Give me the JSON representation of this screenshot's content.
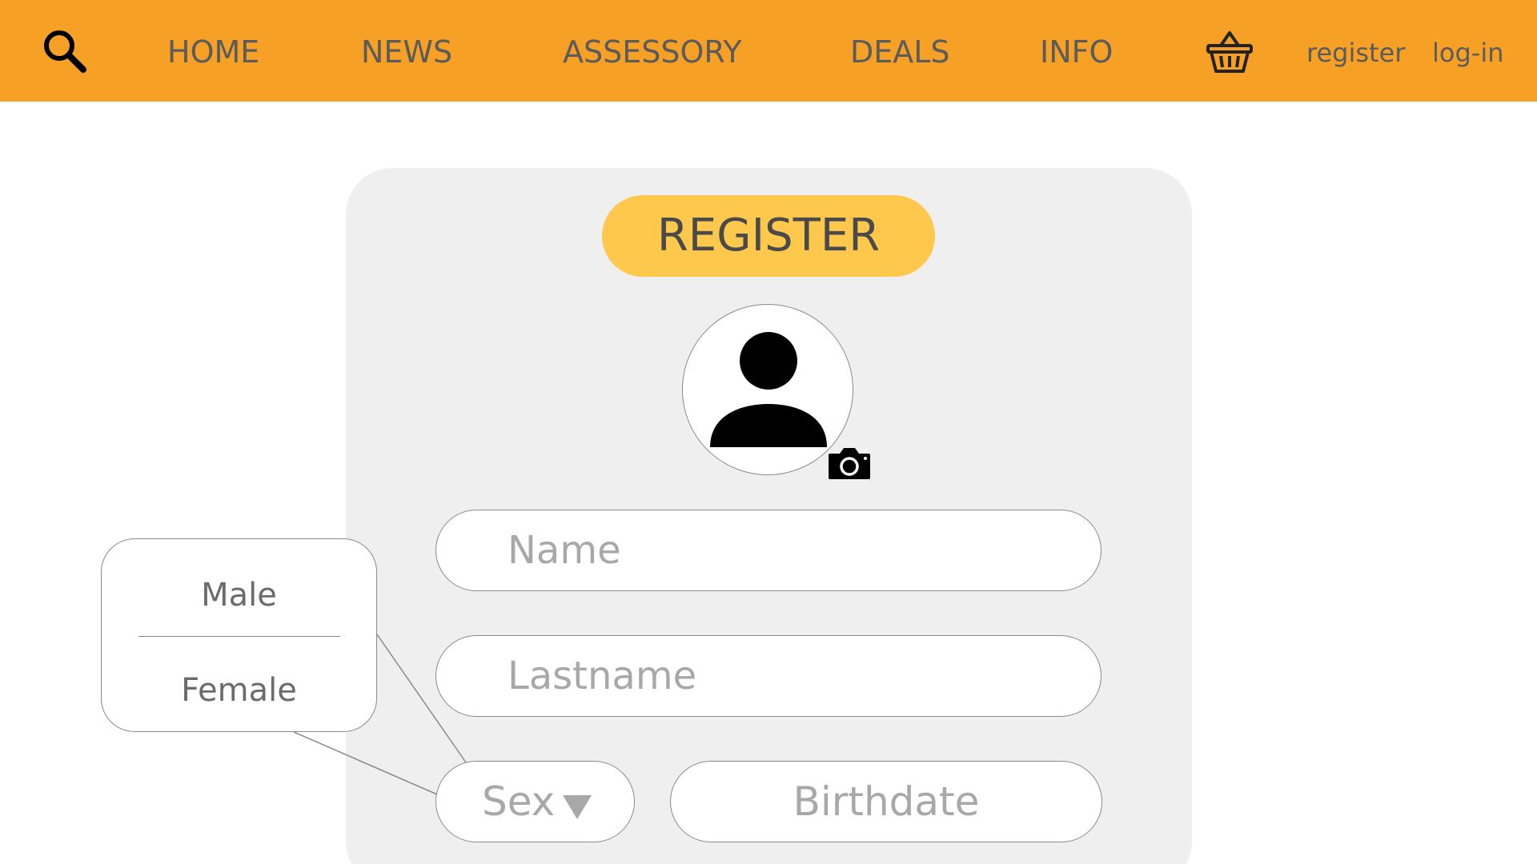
{
  "colors": {
    "nav_background": "#f7a026",
    "title_pill": "#fdc84b",
    "card_background": "#efefef",
    "nav_text": "#5b5b5b",
    "placeholder_text": "#a8a8a8"
  },
  "nav": {
    "search_icon": "search-icon",
    "items": [
      {
        "label": "HOME"
      },
      {
        "label": "NEWS"
      },
      {
        "label": "ASSESSORY"
      },
      {
        "label": "DEALS"
      },
      {
        "label": "INFO"
      }
    ],
    "basket_icon": "basket-icon",
    "register_label": "register",
    "login_label": "log-in"
  },
  "form": {
    "title": "REGISTER",
    "avatar_icon": "user-avatar-icon",
    "camera_icon": "camera-icon",
    "name": {
      "placeholder": "Name",
      "value": ""
    },
    "lastname": {
      "placeholder": "Lastname",
      "value": ""
    },
    "sex": {
      "label": "Sex",
      "icon": "dropdown-triangle-icon"
    },
    "birthdate": {
      "placeholder": "Birthdate",
      "value": ""
    }
  },
  "sex_dropdown": {
    "options": [
      {
        "label": "Male"
      },
      {
        "label": "Female"
      }
    ]
  }
}
